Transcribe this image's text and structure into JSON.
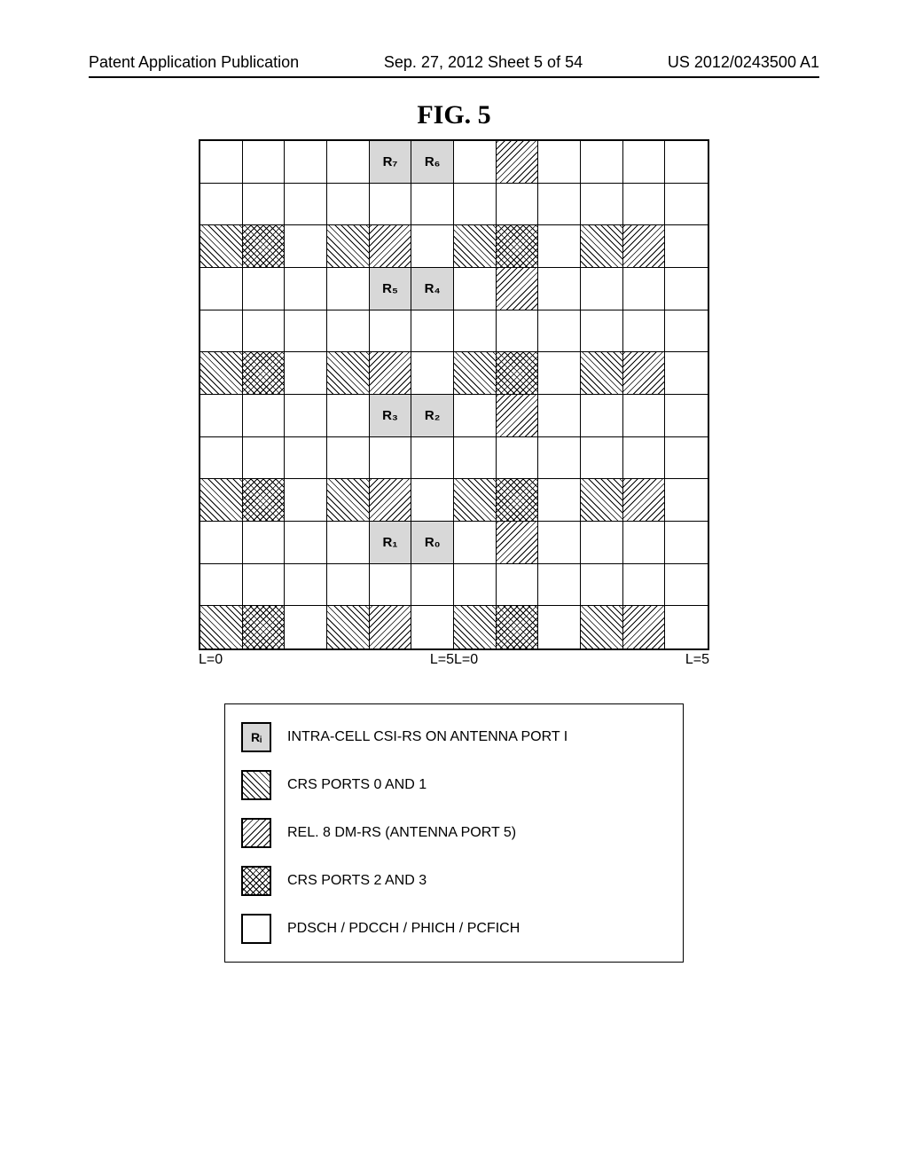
{
  "header": {
    "left": "Patent Application Publication",
    "center": "Sep. 27, 2012  Sheet 5 of 54",
    "right": "US 2012/0243500 A1"
  },
  "figure_title": "FIG. 5",
  "axis": {
    "L0": "L=0",
    "L5": "L=5"
  },
  "legend": [
    {
      "type": "csi_rs",
      "label": "INTRA-CELL CSI-RS ON ANTENNA PORT I",
      "icon_text": "Rᵢ"
    },
    {
      "type": "crs01",
      "label": "CRS PORTS 0 AND 1"
    },
    {
      "type": "dmrs",
      "label": "REL. 8 DM-RS (ANTENNA PORT 5)"
    },
    {
      "type": "crs23",
      "label": "CRS PORTS 2 AND 3"
    },
    {
      "type": "blank",
      "label": "PDSCH / PDCCH / PHICH / PCFICH"
    }
  ],
  "chart_data": {
    "type": "table",
    "rows": 12,
    "cols": 12,
    "row_order": "top_to_bottom",
    "slots_x_axis": [
      [
        "L=0",
        "",
        "",
        "",
        "",
        "L=5"
      ],
      [
        "L=0",
        "",
        "",
        "",
        "",
        "L=5"
      ]
    ],
    "cells": [
      {
        "row": 0,
        "col": 4,
        "type": "csi_rs",
        "text": "R₇"
      },
      {
        "row": 0,
        "col": 5,
        "type": "csi_rs",
        "text": "R₆"
      },
      {
        "row": 0,
        "col": 7,
        "type": "dmrs"
      },
      {
        "row": 2,
        "col": 0,
        "type": "crs01"
      },
      {
        "row": 2,
        "col": 1,
        "type": "crs23"
      },
      {
        "row": 2,
        "col": 3,
        "type": "crs01"
      },
      {
        "row": 2,
        "col": 4,
        "type": "dmrs"
      },
      {
        "row": 2,
        "col": 6,
        "type": "crs01"
      },
      {
        "row": 2,
        "col": 7,
        "type": "crs23"
      },
      {
        "row": 2,
        "col": 9,
        "type": "crs01"
      },
      {
        "row": 2,
        "col": 10,
        "type": "dmrs"
      },
      {
        "row": 3,
        "col": 4,
        "type": "csi_rs",
        "text": "R₅"
      },
      {
        "row": 3,
        "col": 5,
        "type": "csi_rs",
        "text": "R₄"
      },
      {
        "row": 3,
        "col": 7,
        "type": "dmrs"
      },
      {
        "row": 5,
        "col": 0,
        "type": "crs01"
      },
      {
        "row": 5,
        "col": 1,
        "type": "crs23"
      },
      {
        "row": 5,
        "col": 3,
        "type": "crs01"
      },
      {
        "row": 5,
        "col": 4,
        "type": "dmrs"
      },
      {
        "row": 5,
        "col": 6,
        "type": "crs01"
      },
      {
        "row": 5,
        "col": 7,
        "type": "crs23"
      },
      {
        "row": 5,
        "col": 9,
        "type": "crs01"
      },
      {
        "row": 5,
        "col": 10,
        "type": "dmrs"
      },
      {
        "row": 6,
        "col": 4,
        "type": "csi_rs",
        "text": "R₃"
      },
      {
        "row": 6,
        "col": 5,
        "type": "csi_rs",
        "text": "R₂"
      },
      {
        "row": 6,
        "col": 7,
        "type": "dmrs"
      },
      {
        "row": 8,
        "col": 0,
        "type": "crs01"
      },
      {
        "row": 8,
        "col": 1,
        "type": "crs23"
      },
      {
        "row": 8,
        "col": 3,
        "type": "crs01"
      },
      {
        "row": 8,
        "col": 4,
        "type": "dmrs"
      },
      {
        "row": 8,
        "col": 6,
        "type": "crs01"
      },
      {
        "row": 8,
        "col": 7,
        "type": "crs23"
      },
      {
        "row": 8,
        "col": 9,
        "type": "crs01"
      },
      {
        "row": 8,
        "col": 10,
        "type": "dmrs"
      },
      {
        "row": 9,
        "col": 4,
        "type": "csi_rs",
        "text": "R₁"
      },
      {
        "row": 9,
        "col": 5,
        "type": "csi_rs",
        "text": "R₀"
      },
      {
        "row": 9,
        "col": 7,
        "type": "dmrs"
      },
      {
        "row": 11,
        "col": 0,
        "type": "crs01"
      },
      {
        "row": 11,
        "col": 1,
        "type": "crs23"
      },
      {
        "row": 11,
        "col": 3,
        "type": "crs01"
      },
      {
        "row": 11,
        "col": 4,
        "type": "dmrs"
      },
      {
        "row": 11,
        "col": 6,
        "type": "crs01"
      },
      {
        "row": 11,
        "col": 7,
        "type": "crs23"
      },
      {
        "row": 11,
        "col": 9,
        "type": "crs01"
      },
      {
        "row": 11,
        "col": 10,
        "type": "dmrs"
      }
    ]
  }
}
